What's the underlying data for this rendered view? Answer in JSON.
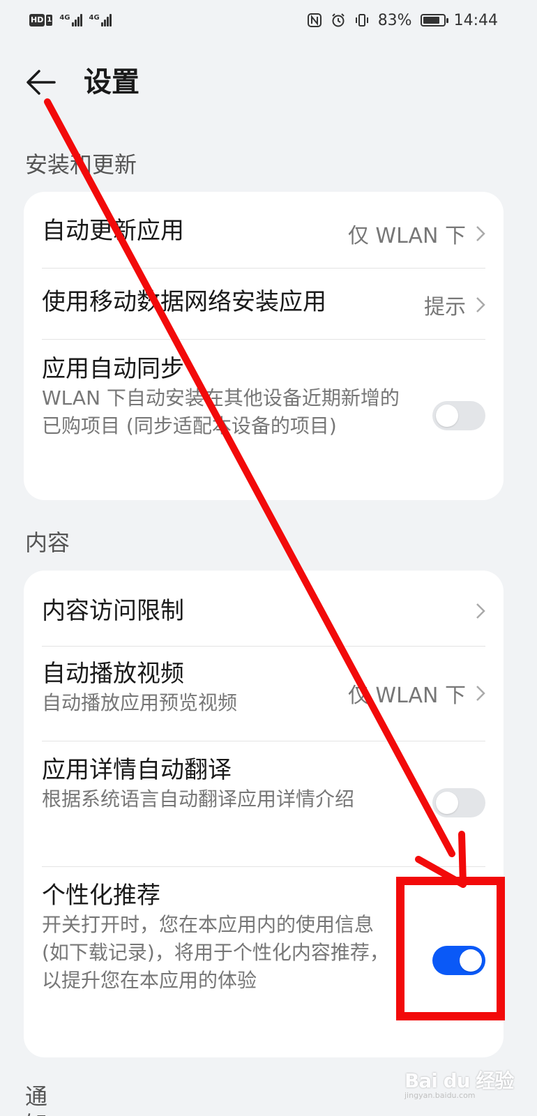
{
  "status_bar": {
    "hd": "HD",
    "sim": "1",
    "net1": "4G",
    "net2": "4G",
    "battery": "83%",
    "time": "14:44",
    "icons": [
      "nfc-icon",
      "alarm-icon",
      "vibrate-icon",
      "battery-icon"
    ]
  },
  "header": {
    "title": "设置",
    "back_icon": "back-arrow-icon"
  },
  "sections": {
    "install": {
      "label": "安装和更新",
      "items": [
        {
          "title": "自动更新应用",
          "value": "仅 WLAN 下"
        },
        {
          "title": "使用移动数据网络安装应用",
          "value": "提示"
        },
        {
          "title": "应用自动同步",
          "subtitle": "WLAN 下自动安装在其他设备近期新增的已购项目 (同步适配本设备的项目)",
          "toggle": false
        }
      ]
    },
    "content": {
      "label": "内容",
      "items": [
        {
          "title": "内容访问限制"
        },
        {
          "title": "自动播放视频",
          "subtitle": "自动播放应用预览视频",
          "value": "仅 WLAN 下"
        },
        {
          "title": "应用详情自动翻译",
          "subtitle": "根据系统语言自动翻译应用详情介绍",
          "toggle": false
        },
        {
          "title": "个性化推荐",
          "subtitle": "开关打开时，您在本应用内的使用信息 (如下载记录)，将用于个性化内容推荐，以提升您在本应用的体验",
          "toggle": true
        }
      ]
    },
    "next_label": "通知"
  },
  "annotation": {
    "color": "#f20a0a"
  },
  "colors": {
    "accent": "#0a59f7",
    "background": "#f1f3f5",
    "card": "#ffffff"
  },
  "watermark": {
    "brand": "Bai du 经验",
    "url": "jingyan.baidu.com"
  }
}
